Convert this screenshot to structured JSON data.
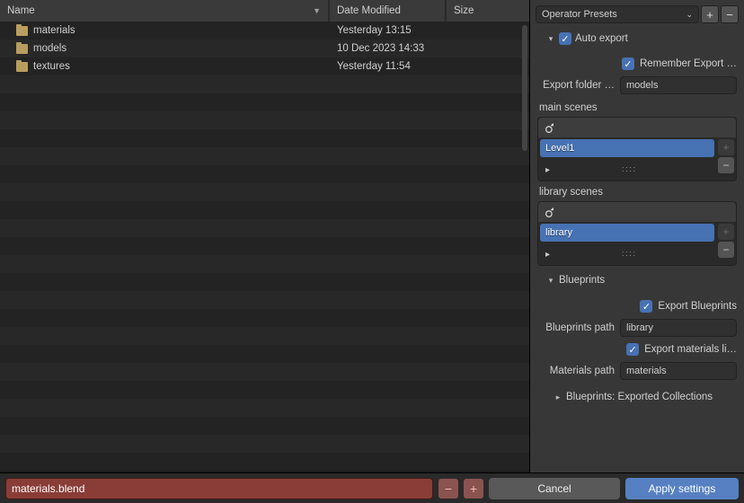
{
  "header": {
    "cols": {
      "name": "Name",
      "date": "Date Modified",
      "size": "Size"
    }
  },
  "files": [
    {
      "name": "materials",
      "date": "Yesterday 13:15",
      "size": ""
    },
    {
      "name": "models",
      "date": "10 Dec 2023 14:33",
      "size": ""
    },
    {
      "name": "textures",
      "date": "Yesterday 11:54",
      "size": ""
    }
  ],
  "preset": {
    "label": "Operator Presets"
  },
  "auto_export": {
    "title": "Auto export",
    "remember": "Remember Export …",
    "export_folder_label": "Export folder …",
    "export_folder_value": "models"
  },
  "main_scenes": {
    "title": "main scenes",
    "items": [
      "Level1"
    ]
  },
  "library_scenes": {
    "title": "library scenes",
    "items": [
      "library"
    ]
  },
  "blueprints": {
    "title": "Blueprints",
    "export_bp": "Export Blueprints",
    "bp_path_label": "Blueprints path",
    "bp_path_value": "library",
    "export_materials": "Export materials li…",
    "mat_path_label": "Materials path",
    "mat_path_value": "materials",
    "exported_collections": "Blueprints: Exported Collections"
  },
  "bottom": {
    "filename": "materials.blend",
    "cancel": "Cancel",
    "apply": "Apply settings"
  }
}
